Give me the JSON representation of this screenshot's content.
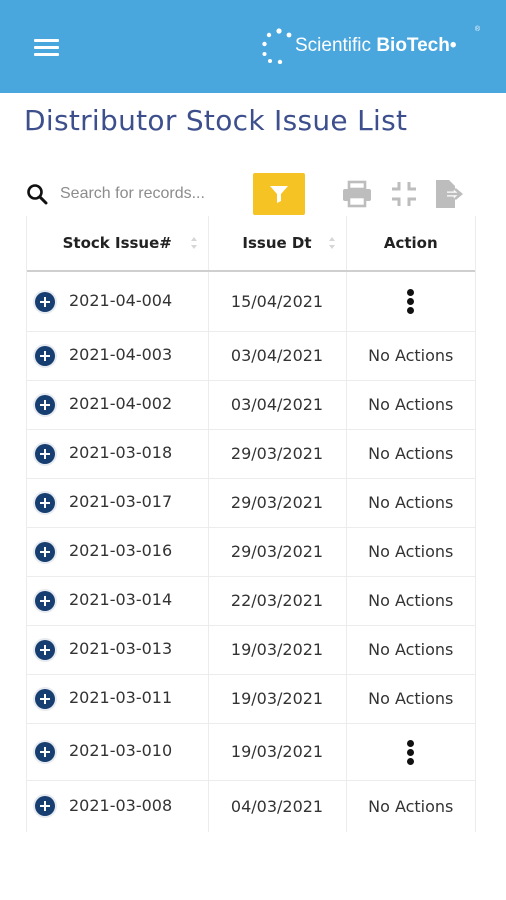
{
  "header": {
    "brand_name_light": "Scientific ",
    "brand_name_bold": "BioTech",
    "brand_mark": "•",
    "brand_tm": "®",
    "bar_color": "#4aa7de"
  },
  "page": {
    "title": "Distributor Stock Issue List"
  },
  "toolbar": {
    "search_placeholder": "Search for records...",
    "filter_color": "#f6c324",
    "icons": [
      "search-icon",
      "filter-icon",
      "print-icon",
      "collapse-icon",
      "export-icon"
    ]
  },
  "table": {
    "columns": [
      "Stock Issue#",
      "Issue Dt",
      "Action"
    ],
    "rows": [
      {
        "issue_no": "2021-04-004",
        "issue_dt": "15/04/2021",
        "action": "",
        "has_menu": true
      },
      {
        "issue_no": "2021-04-003",
        "issue_dt": "03/04/2021",
        "action": "No Actions",
        "has_menu": false
      },
      {
        "issue_no": "2021-04-002",
        "issue_dt": "03/04/2021",
        "action": "No Actions",
        "has_menu": false
      },
      {
        "issue_no": "2021-03-018",
        "issue_dt": "29/03/2021",
        "action": "No Actions",
        "has_menu": false
      },
      {
        "issue_no": "2021-03-017",
        "issue_dt": "29/03/2021",
        "action": "No Actions",
        "has_menu": false
      },
      {
        "issue_no": "2021-03-016",
        "issue_dt": "29/03/2021",
        "action": "No Actions",
        "has_menu": false
      },
      {
        "issue_no": "2021-03-014",
        "issue_dt": "22/03/2021",
        "action": "No Actions",
        "has_menu": false
      },
      {
        "issue_no": "2021-03-013",
        "issue_dt": "19/03/2021",
        "action": "No Actions",
        "has_menu": false
      },
      {
        "issue_no": "2021-03-011",
        "issue_dt": "19/03/2021",
        "action": "No Actions",
        "has_menu": false
      },
      {
        "issue_no": "2021-03-010",
        "issue_dt": "19/03/2021",
        "action": "",
        "has_menu": true
      },
      {
        "issue_no": "2021-03-008",
        "issue_dt": "04/03/2021",
        "action": "No Actions",
        "has_menu": false
      }
    ]
  }
}
